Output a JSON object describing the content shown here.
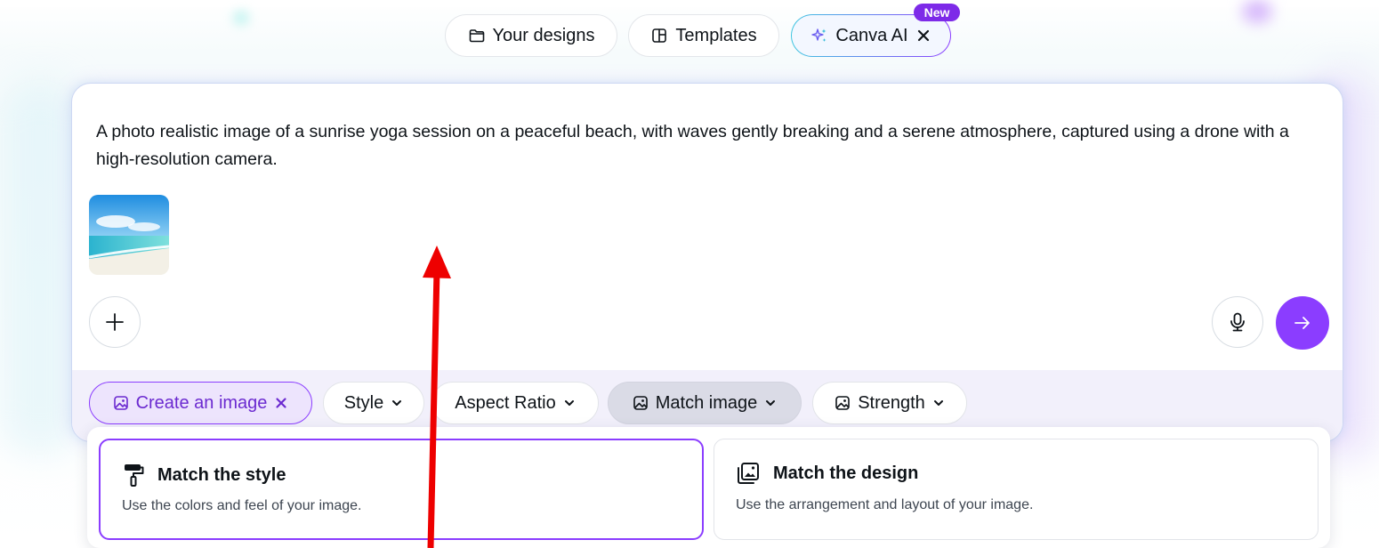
{
  "colors": {
    "accent": "#8b3dff",
    "accent_dark": "#7d2ae8",
    "chip_active_bg": "#ede4fd",
    "toolbar_bg": "#f2f0fb",
    "annotation_arrow": "#ee0000"
  },
  "nav": {
    "items": [
      {
        "label": "Your designs",
        "icon": "folder-icon"
      },
      {
        "label": "Templates",
        "icon": "templates-icon"
      },
      {
        "label": "Canva AI",
        "icon": "sparkle-icon",
        "close_icon": "close-icon",
        "badge": "New"
      }
    ]
  },
  "prompt": {
    "text": "A photo realistic image of a sunrise yoga session on a peaceful beach, with waves gently breaking and a serene atmosphere, captured using a drone with a high-resolution camera.",
    "attachment_icon": "image-thumbnail",
    "add_icon": "plus-icon",
    "mic_icon": "microphone-icon",
    "send_icon": "arrow-right-icon"
  },
  "toolbar": {
    "chips": [
      {
        "label": "Create an image",
        "icon": "image-icon",
        "trailing": "close-icon",
        "active": true
      },
      {
        "label": "Style",
        "trailing": "chevron-down-icon"
      },
      {
        "label": "Aspect Ratio",
        "trailing": "chevron-down-icon"
      },
      {
        "label": "Match image",
        "icon": "image-icon",
        "trailing": "chevron-down-icon",
        "open": true
      },
      {
        "label": "Strength",
        "icon": "image-icon",
        "trailing": "chevron-down-icon"
      }
    ]
  },
  "dropdown": {
    "options": [
      {
        "title": "Match the style",
        "description": "Use the colors and feel of your image.",
        "icon": "paint-roller-icon",
        "selected": true
      },
      {
        "title": "Match the design",
        "description": "Use the arrangement and layout of your image.",
        "icon": "layout-image-icon",
        "selected": false
      }
    ]
  }
}
